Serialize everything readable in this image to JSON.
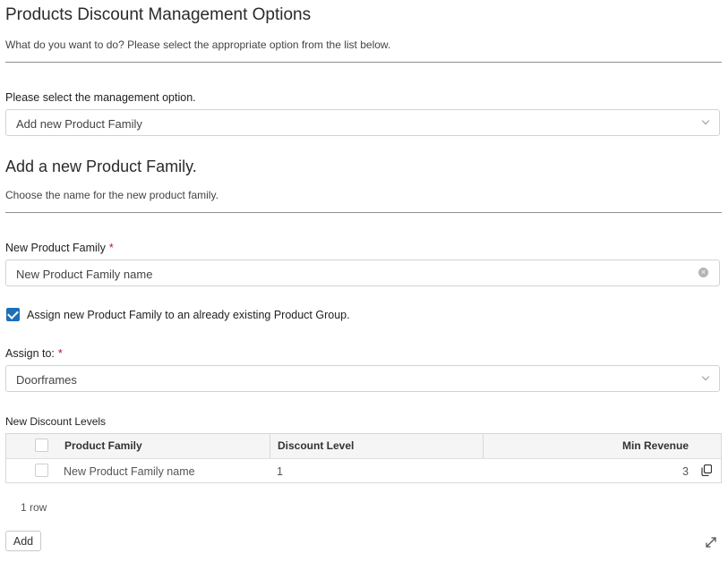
{
  "header": {
    "title": "Products Discount Management Options",
    "subtitle": "What do you want to do? Please select the appropriate option from the list below."
  },
  "management": {
    "label": "Please select the management option.",
    "selected": "Add new Product Family"
  },
  "section": {
    "title": "Add a new Product Family.",
    "subtitle": "Choose the name for the new product family."
  },
  "family_field": {
    "label": "New Product Family",
    "required_mark": "*",
    "value": "New Product Family name"
  },
  "assign_checkbox": {
    "checked": true,
    "label": "Assign new Product Family to an already existing Product Group."
  },
  "assign_to": {
    "label": "Assign to:",
    "required_mark": "*",
    "selected": "Doorframes"
  },
  "discount_table": {
    "title": "New Discount Levels",
    "columns": [
      "Product Family",
      "Discount Level",
      "Min Revenue"
    ],
    "rows": [
      {
        "product_family": "New Product Family name",
        "discount_level": "1",
        "min_revenue": "3"
      }
    ],
    "row_count": "1 row"
  },
  "actions": {
    "add_label": "Add"
  },
  "colors": {
    "accent": "#1d6fb8",
    "required": "#c0103a"
  }
}
